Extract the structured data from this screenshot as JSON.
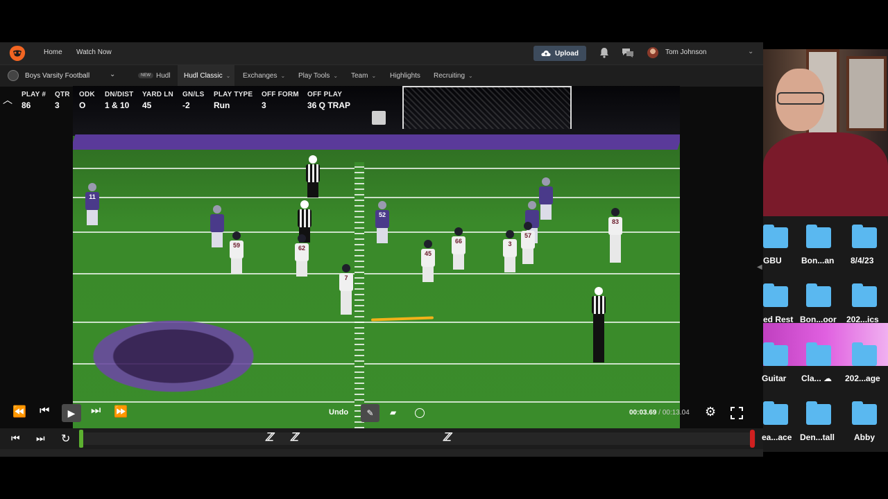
{
  "nav": {
    "home": "Home",
    "watch_now": "Watch Now",
    "upload": "Upload",
    "user_name": "Tom Johnson"
  },
  "subnav": {
    "team": "Boys Varsity Football",
    "new_badge": "NEW",
    "items": [
      "Hudl",
      "Hudl Classic",
      "Exchanges",
      "Play Tools",
      "Team",
      "Highlights",
      "Recruiting"
    ]
  },
  "play_info": {
    "labels": [
      "PLAY #",
      "QTR",
      "ODK",
      "DN/DIST",
      "YARD LN",
      "GN/LS",
      "PLAY TYPE",
      "OFF FORM",
      "OFF PLAY"
    ],
    "values": [
      "86",
      "3",
      "O",
      "1 & 10",
      "45",
      "-2",
      "Run",
      "3",
      "36 Q TRAP"
    ]
  },
  "jersey_numbers": {
    "white": [
      "59",
      "62",
      "7",
      "45",
      "66",
      "3",
      "57",
      "83"
    ],
    "purple": [
      "11",
      "52"
    ]
  },
  "player": {
    "undo": "Undo",
    "current_time": "00:03.69",
    "separator": " / ",
    "duration": "00:13.04"
  },
  "desktop": {
    "folders": [
      "GBU",
      "Bon...an",
      "8/4/23",
      "ed Rest",
      "Bon...oor",
      "202...ics",
      "Guitar",
      "Cla...",
      "202...age",
      "ea...ace",
      "Den...tall",
      "Abby"
    ]
  },
  "colors": {
    "upload_bg": "#3d4b5c",
    "annotation_line": "#f2b11a",
    "timeline_start": "#5cb030",
    "timeline_end": "#d02020",
    "folder": "#5ab8f0"
  }
}
